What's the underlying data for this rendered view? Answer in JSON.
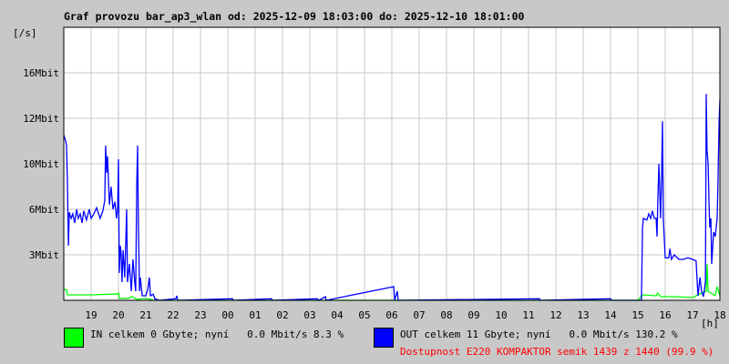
{
  "title": "Graf provozu bar_ap3_wlan od: 2025-12-09 18:03:00 do: 2025-12-10 18:01:00",
  "chart_data": {
    "type": "line",
    "title": "Graf provozu bar_ap3_wlan od: 2025-12-09 18:03:00 do: 2025-12-10 18:01:00",
    "ylabel": "[/s]",
    "xlabel": "[h]",
    "xlim": [
      0,
      24
    ],
    "ylim": [
      0,
      18
    ],
    "grid": true,
    "x_ticks": [
      "19",
      "20",
      "21",
      "22",
      "23",
      "00",
      "01",
      "02",
      "03",
      "04",
      "05",
      "06",
      "07",
      "08",
      "09",
      "10",
      "11",
      "12",
      "13",
      "14",
      "15",
      "16",
      "17",
      "18"
    ],
    "y_ticks": [
      {
        "value": 3,
        "label": "3Mbit"
      },
      {
        "value": 6,
        "label": "6Mbit"
      },
      {
        "value": 9,
        "label": "10Mbit"
      },
      {
        "value": 12,
        "label": "12Mbit"
      },
      {
        "value": 15,
        "label": "16Mbit"
      }
    ],
    "series": [
      {
        "name": "IN",
        "color": "#00ff00",
        "points": [
          [
            0,
            0.7
          ],
          [
            0.1,
            0.7
          ],
          [
            0.13,
            0.36
          ],
          [
            1.0,
            0.36
          ],
          [
            1.97,
            0.42
          ],
          [
            2.0,
            0.48
          ],
          [
            2.03,
            0.12
          ],
          [
            2.33,
            0.12
          ],
          [
            2.5,
            0.24
          ],
          [
            2.67,
            0.06
          ],
          [
            3.0,
            0.12
          ],
          [
            3.33,
            0
          ],
          [
            21.0,
            0
          ],
          [
            21.17,
            0.36
          ],
          [
            21.67,
            0.3
          ],
          [
            21.73,
            0.48
          ],
          [
            21.83,
            0.24
          ],
          [
            22.33,
            0.24
          ],
          [
            23.0,
            0.18
          ],
          [
            23.33,
            0.48
          ],
          [
            23.5,
            0.6
          ],
          [
            23.53,
            2.4
          ],
          [
            23.57,
            0.6
          ],
          [
            23.83,
            0.3
          ],
          [
            23.9,
            0.9
          ],
          [
            24,
            0.3
          ]
        ]
      },
      {
        "name": "OUT",
        "color": "#0000ff",
        "points": [
          [
            0,
            10.9
          ],
          [
            0.07,
            10.5
          ],
          [
            0.1,
            10.2
          ],
          [
            0.13,
            8.1
          ],
          [
            0.17,
            3.6
          ],
          [
            0.2,
            5.8
          ],
          [
            0.27,
            5.4
          ],
          [
            0.33,
            5.7
          ],
          [
            0.4,
            5.1
          ],
          [
            0.47,
            6.0
          ],
          [
            0.53,
            5.4
          ],
          [
            0.6,
            5.7
          ],
          [
            0.67,
            5.1
          ],
          [
            0.73,
            5.9
          ],
          [
            0.83,
            5.3
          ],
          [
            0.93,
            6.0
          ],
          [
            1.0,
            5.4
          ],
          [
            1.1,
            5.7
          ],
          [
            1.2,
            6.1
          ],
          [
            1.33,
            5.4
          ],
          [
            1.43,
            5.9
          ],
          [
            1.5,
            6.6
          ],
          [
            1.53,
            10.2
          ],
          [
            1.57,
            8.4
          ],
          [
            1.6,
            9.5
          ],
          [
            1.67,
            6.3
          ],
          [
            1.73,
            7.5
          ],
          [
            1.8,
            6.0
          ],
          [
            1.87,
            6.5
          ],
          [
            1.93,
            5.4
          ],
          [
            1.97,
            6.0
          ],
          [
            2.0,
            9.3
          ],
          [
            2.03,
            1.8
          ],
          [
            2.07,
            3.6
          ],
          [
            2.1,
            3.0
          ],
          [
            2.13,
            1.2
          ],
          [
            2.17,
            3.3
          ],
          [
            2.23,
            1.5
          ],
          [
            2.3,
            6.0
          ],
          [
            2.33,
            1.2
          ],
          [
            2.4,
            2.4
          ],
          [
            2.47,
            0.6
          ],
          [
            2.53,
            2.7
          ],
          [
            2.6,
            1.1
          ],
          [
            2.63,
            0.6
          ],
          [
            2.67,
            7.8
          ],
          [
            2.7,
            10.2
          ],
          [
            2.73,
            4.8
          ],
          [
            2.77,
            0.6
          ],
          [
            2.8,
            1.5
          ],
          [
            2.87,
            0.3
          ],
          [
            3.0,
            0.3
          ],
          [
            3.07,
            0.7
          ],
          [
            3.13,
            1.5
          ],
          [
            3.17,
            0.3
          ],
          [
            3.27,
            0.4
          ],
          [
            3.33,
            0.1
          ],
          [
            3.5,
            0
          ],
          [
            4.1,
            0.1
          ],
          [
            4.13,
            0.3
          ],
          [
            4.17,
            0
          ],
          [
            6.17,
            0.1
          ],
          [
            6.2,
            0
          ],
          [
            7.6,
            0.1
          ],
          [
            7.63,
            0
          ],
          [
            9.27,
            0.1
          ],
          [
            9.33,
            0
          ],
          [
            9.57,
            0.24
          ],
          [
            9.6,
            0
          ],
          [
            12.07,
            0.9
          ],
          [
            12.1,
            0
          ],
          [
            12.2,
            0.6
          ],
          [
            12.23,
            0
          ],
          [
            17.4,
            0.1
          ],
          [
            17.43,
            0
          ],
          [
            20.0,
            0.1
          ],
          [
            20.03,
            0
          ],
          [
            21.13,
            0
          ],
          [
            21.17,
            4.8
          ],
          [
            21.2,
            5.4
          ],
          [
            21.33,
            5.3
          ],
          [
            21.4,
            5.7
          ],
          [
            21.47,
            5.4
          ],
          [
            21.53,
            5.9
          ],
          [
            21.6,
            5.4
          ],
          [
            21.67,
            5.4
          ],
          [
            21.7,
            4.2
          ],
          [
            21.73,
            6.6
          ],
          [
            21.77,
            9.0
          ],
          [
            21.8,
            7.2
          ],
          [
            21.83,
            5.4
          ],
          [
            21.87,
            8.4
          ],
          [
            21.9,
            11.8
          ],
          [
            21.93,
            5.4
          ],
          [
            22.0,
            2.8
          ],
          [
            22.13,
            2.8
          ],
          [
            22.17,
            3.4
          ],
          [
            22.23,
            2.7
          ],
          [
            22.33,
            3.0
          ],
          [
            22.5,
            2.7
          ],
          [
            22.67,
            2.7
          ],
          [
            22.83,
            2.8
          ],
          [
            23.0,
            2.7
          ],
          [
            23.13,
            2.6
          ],
          [
            23.17,
            1.2
          ],
          [
            23.2,
            0.3
          ],
          [
            23.27,
            1.5
          ],
          [
            23.33,
            0.6
          ],
          [
            23.4,
            0.24
          ],
          [
            23.47,
            1.2
          ],
          [
            23.48,
            4.8
          ],
          [
            23.5,
            13.6
          ],
          [
            23.53,
            9.9
          ],
          [
            23.57,
            9.0
          ],
          [
            23.6,
            6.6
          ],
          [
            23.63,
            4.8
          ],
          [
            23.67,
            5.4
          ],
          [
            23.7,
            2.4
          ],
          [
            23.77,
            4.5
          ],
          [
            23.83,
            4.2
          ],
          [
            23.9,
            5.4
          ],
          [
            23.93,
            7.8
          ],
          [
            23.97,
            11.7
          ],
          [
            24,
            13.2
          ]
        ]
      }
    ]
  },
  "legend": {
    "in": {
      "text": "IN celkem 0 Gbyte; nyní   0.0 Mbit/s 8.3 %",
      "color": "#00ff00"
    },
    "out": {
      "text": "OUT celkem 11 Gbyte; nyní   0.0 Mbit/s 130.2 %",
      "color": "#0000ff"
    },
    "availability": "Dostupnost E220 KOMPAKTOR semik 1439 z 1440 (99.9 %)",
    "availability_color": "#ff0000"
  }
}
